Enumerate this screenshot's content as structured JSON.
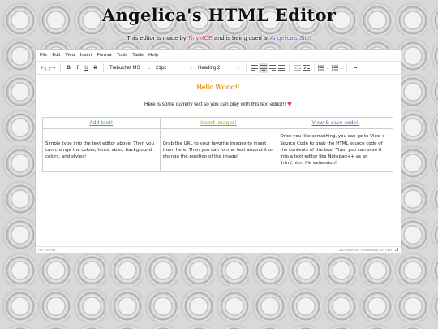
{
  "page": {
    "title": "Angelica's HTML Editor",
    "subtitle_pre": "This editor is made by ",
    "subtitle_link1": "TinyMCE",
    "subtitle_mid": " and is being used at ",
    "subtitle_link2": "Angelica's Site!",
    "colors": {
      "pink": "#e0436e",
      "purple": "#8a4fc8",
      "orange": "#e69524",
      "teal": "#2aa398",
      "olive": "#b5a100"
    }
  },
  "menubar": {
    "items": [
      "File",
      "Edit",
      "View",
      "Insert",
      "Format",
      "Tools",
      "Table",
      "Help"
    ]
  },
  "toolbar": {
    "undo_icon": "undo-icon",
    "redo_icon": "redo-icon",
    "bold": "B",
    "italic": "I",
    "underline": "U",
    "strike": "S",
    "font_family": "Trebuchet MS",
    "font_size": "21px",
    "block_format": "Heading 2",
    "more": "•••"
  },
  "content": {
    "hello": "Hello World!!",
    "dummy": "Here is some dummy text so you can play with this text editor!!",
    "heart": "♥",
    "table": {
      "headers": [
        "Add text!",
        "Insert images!",
        "View & save code!"
      ],
      "cells": [
        "Simply type into the text editor above. Then you can change the colors, fonts, sizes, background colors, and styles!",
        "Grab the URL to your favorite images to insert them here. Then you can format text around it or change the position of the image!",
        "Once you like something, you can go to View > Source Code to grab the HTML source code of the contents of the box! Then you can save it into a text editor like Notepad++ as an .htm/.html file extension!"
      ]
    }
  },
  "statusbar": {
    "path": "H2 » SPAN",
    "words": "110 WORDS",
    "powered": "POWERED BY TINY"
  }
}
